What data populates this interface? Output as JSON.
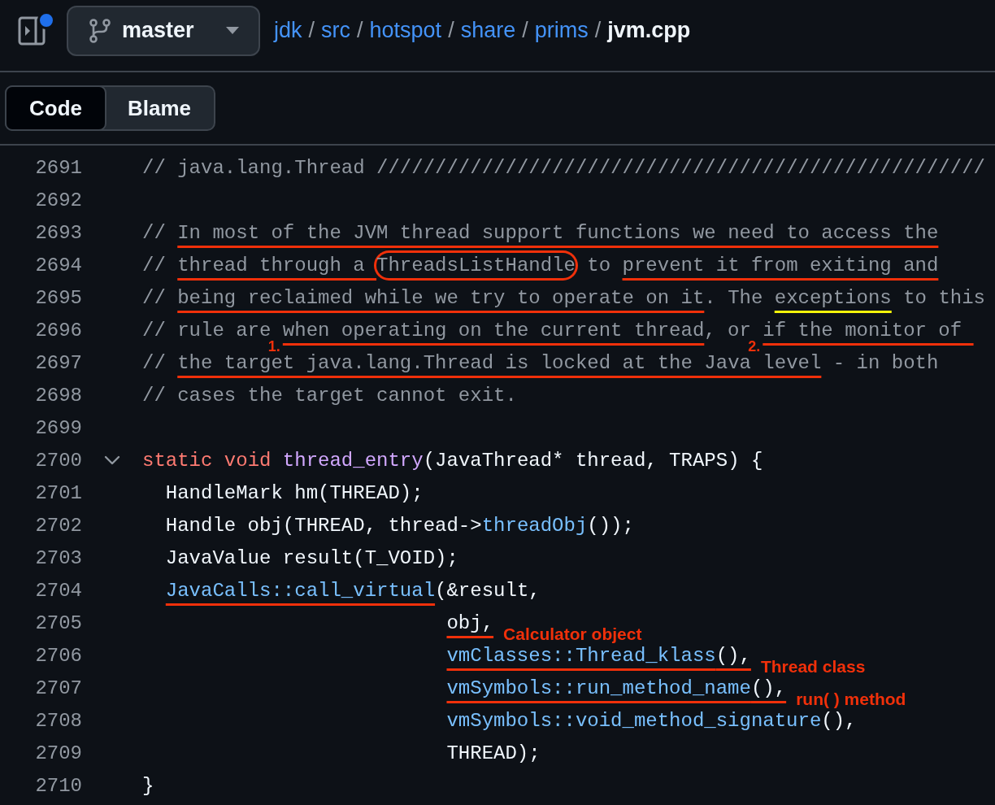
{
  "header": {
    "notification": true,
    "branch": "master",
    "breadcrumb": {
      "links": [
        "jdk",
        "src",
        "hotspot",
        "share",
        "prims"
      ],
      "separator": "/",
      "file": "jvm.cpp"
    }
  },
  "tabs": [
    {
      "label": "Code",
      "selected": true
    },
    {
      "label": "Blame",
      "selected": false
    }
  ],
  "lines": [
    {
      "number": "2691",
      "tokens": [
        {
          "text": "// java.lang.Thread ////////////////////////////////////////////////////",
          "kind": "comment"
        }
      ]
    },
    {
      "number": "2692"
    },
    {
      "number": "2693",
      "tokens": [
        {
          "text": "// ",
          "kind": "comment"
        },
        {
          "text": "In most of the JVM thread support functions we need to access the",
          "kind": "comment",
          "annotation": {
            "kind": "underline"
          }
        }
      ]
    },
    {
      "number": "2694",
      "tokens": [
        {
          "text": "// ",
          "kind": "comment"
        },
        {
          "text": "thread through a ",
          "kind": "comment",
          "annotation": {
            "kind": "underline"
          }
        },
        {
          "text": "ThreadsListHandle",
          "kind": "comment",
          "annotation": {
            "kind": "circle"
          }
        },
        {
          "text": " to ",
          "kind": "comment"
        },
        {
          "text": "prevent it from exiting and",
          "kind": "comment",
          "annotation": {
            "kind": "underline"
          }
        }
      ]
    },
    {
      "number": "2695",
      "tokens": [
        {
          "text": "// ",
          "kind": "comment"
        },
        {
          "text": "being reclaimed while we try to operate on it",
          "kind": "comment",
          "annotation": {
            "kind": "underline"
          }
        },
        {
          "text": ". The ",
          "kind": "comment"
        },
        {
          "text": "exceptions",
          "kind": "comment",
          "annotation": {
            "kind": "highlight"
          }
        },
        {
          "text": " to this",
          "kind": "comment"
        }
      ]
    },
    {
      "number": "2696",
      "tokens": [
        {
          "text": "// rule are ",
          "kind": "comment"
        },
        {
          "text": "when operating on the current thread",
          "kind": "comment",
          "annotation": {
            "kind": "underline",
            "note": {
              "text": "1.",
              "kind": "below"
            }
          }
        },
        {
          "text": ", or ",
          "kind": "comment"
        },
        {
          "text": "if the monitor of ",
          "kind": "comment",
          "annotation": {
            "kind": "underline",
            "note": {
              "text": "2.",
              "kind": "below"
            }
          }
        }
      ]
    },
    {
      "number": "2697",
      "tokens": [
        {
          "text": "// ",
          "kind": "comment"
        },
        {
          "text": "the target java.lang.Thread is locked at the Java level",
          "kind": "comment",
          "annotation": {
            "kind": "underline"
          }
        },
        {
          "text": " - in both",
          "kind": "comment"
        }
      ]
    },
    {
      "number": "2698",
      "tokens": [
        {
          "text": "// cases the target cannot exit.",
          "kind": "comment"
        }
      ]
    },
    {
      "number": "2699"
    },
    {
      "number": "2700",
      "fold": {
        "expanded": true
      },
      "tokens": [
        {
          "text": "static ",
          "kind": "keyword"
        },
        {
          "text": "void ",
          "kind": "keyword"
        },
        {
          "text": "thread_entry",
          "kind": "function"
        },
        {
          "text": "(JavaThread* thread, TRAPS) {",
          "kind": "plain"
        }
      ]
    },
    {
      "number": "2701",
      "kind": "body",
      "tokens": [
        {
          "text": "HandleMark hm(THREAD);",
          "kind": "plain"
        }
      ]
    },
    {
      "number": "2702",
      "kind": "body",
      "tokens": [
        {
          "text": "Handle obj(THREAD, thread->",
          "kind": "plain"
        },
        {
          "text": "threadObj",
          "kind": "call"
        },
        {
          "text": "());",
          "kind": "plain"
        }
      ]
    },
    {
      "number": "2703",
      "kind": "body",
      "tokens": [
        {
          "text": "JavaValue result(T_VOID);",
          "kind": "plain"
        }
      ]
    },
    {
      "number": "2704",
      "kind": "body",
      "tokens": [
        {
          "text": "JavaCalls::call_virtual",
          "kind": "call",
          "annotation": {
            "kind": "underline"
          }
        },
        {
          "text": "(&result,",
          "kind": "plain"
        }
      ]
    },
    {
      "number": "2705",
      "kind": "argument",
      "tokens": [
        {
          "text": "obj,",
          "kind": "plain",
          "annotation": {
            "kind": "underline",
            "note": {
              "text": "Calculator object",
              "kind": "after"
            }
          }
        }
      ]
    },
    {
      "number": "2706",
      "kind": "argument",
      "tokens": [
        {
          "text": "vmClasses::Thread_klass",
          "kind": "call",
          "annotation": {
            "kind": "underline"
          }
        },
        {
          "text": "(),",
          "kind": "plain",
          "annotation": {
            "kind": "underline",
            "note": {
              "text": "Thread class",
              "kind": "after"
            }
          }
        }
      ]
    },
    {
      "number": "2707",
      "kind": "argument",
      "tokens": [
        {
          "text": "vmSymbols::run_method_name",
          "kind": "call",
          "annotation": {
            "kind": "underline"
          }
        },
        {
          "text": "(),",
          "kind": "plain",
          "annotation": {
            "kind": "underline",
            "note": {
              "text": "run( ) method",
              "kind": "after"
            }
          }
        }
      ]
    },
    {
      "number": "2708",
      "kind": "argument",
      "tokens": [
        {
          "text": "vmSymbols::void_method_signature",
          "kind": "call"
        },
        {
          "text": "(),",
          "kind": "plain"
        }
      ]
    },
    {
      "number": "2709",
      "kind": "argument",
      "tokens": [
        {
          "text": "THREAD);",
          "kind": "plain"
        }
      ]
    },
    {
      "number": "2710",
      "tokens": [
        {
          "text": "}",
          "kind": "plain"
        }
      ]
    }
  ]
}
